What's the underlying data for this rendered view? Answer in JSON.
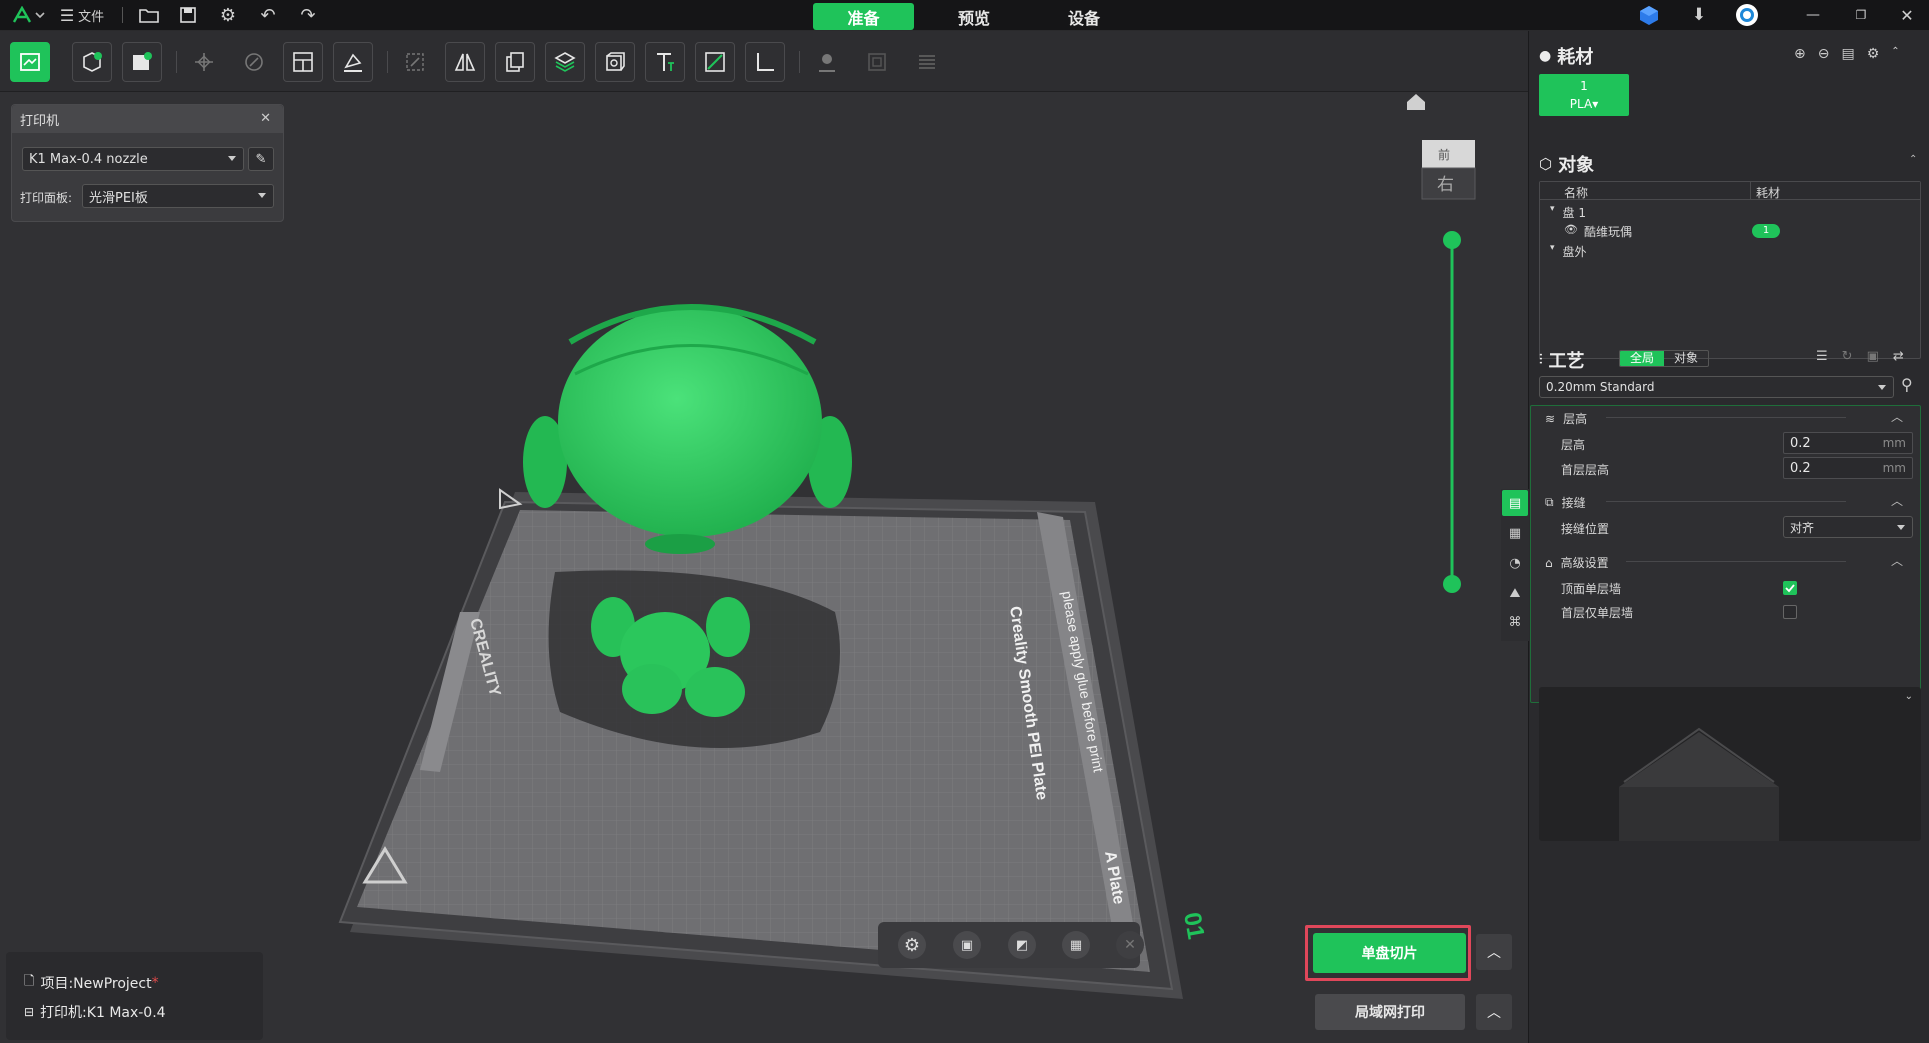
{
  "topbar": {
    "file_label": "文件",
    "tabs": [
      {
        "label": "准备",
        "active": true
      },
      {
        "label": "预览",
        "active": false
      },
      {
        "label": "设备",
        "active": false
      }
    ]
  },
  "printer_panel": {
    "title": "打印机",
    "printer_select": "K1 Max-0.4 nozzle",
    "plate_label": "打印面板:",
    "plate_select": "光滑PEI板"
  },
  "filament": {
    "title": "耗材",
    "slot_number": "1",
    "slot_type": "PLA",
    "slot_color": "#1fc35a"
  },
  "objects": {
    "title": "对象",
    "col_name": "名称",
    "col_filament": "耗材",
    "plate1": "盘 1",
    "object_name": "酷维玩偶",
    "object_filament": "1",
    "outside": "盘外"
  },
  "process": {
    "title": "工艺",
    "tab_global": "全局",
    "tab_object": "对象",
    "profile": "0.20mm Standard",
    "groups": {
      "layer_height": {
        "title": "层高",
        "layer_height_label": "层高",
        "layer_height_value": "0.2",
        "first_layer_label": "首层层高",
        "first_layer_value": "0.2",
        "unit": "mm"
      },
      "seam": {
        "title": "接缝",
        "seam_position_label": "接缝位置",
        "seam_position_value": "对齐"
      },
      "advanced": {
        "title": "高级设置",
        "top_one_wall_label": "顶面单层墙",
        "top_one_wall_checked": true,
        "first_one_wall_label": "首层仅单层墙",
        "first_one_wall_checked": false
      }
    }
  },
  "viewport": {
    "plate_number": "01",
    "view_cube_top": "前",
    "view_cube_side": "右",
    "plate_text_1": "Creality Smooth PEI Plate",
    "plate_text_2": "please apply glue before print",
    "plate_text_3": "A Plate",
    "plate_text_4": "CREALITY",
    "model_color": "#2fd160"
  },
  "actions": {
    "slice_button": "单盘切片",
    "lan_print_button": "局域网打印"
  },
  "project": {
    "project_label": "项目:NewProject",
    "modified_mark": "*",
    "printer_label": "打印机:K1  Max-0.4"
  }
}
